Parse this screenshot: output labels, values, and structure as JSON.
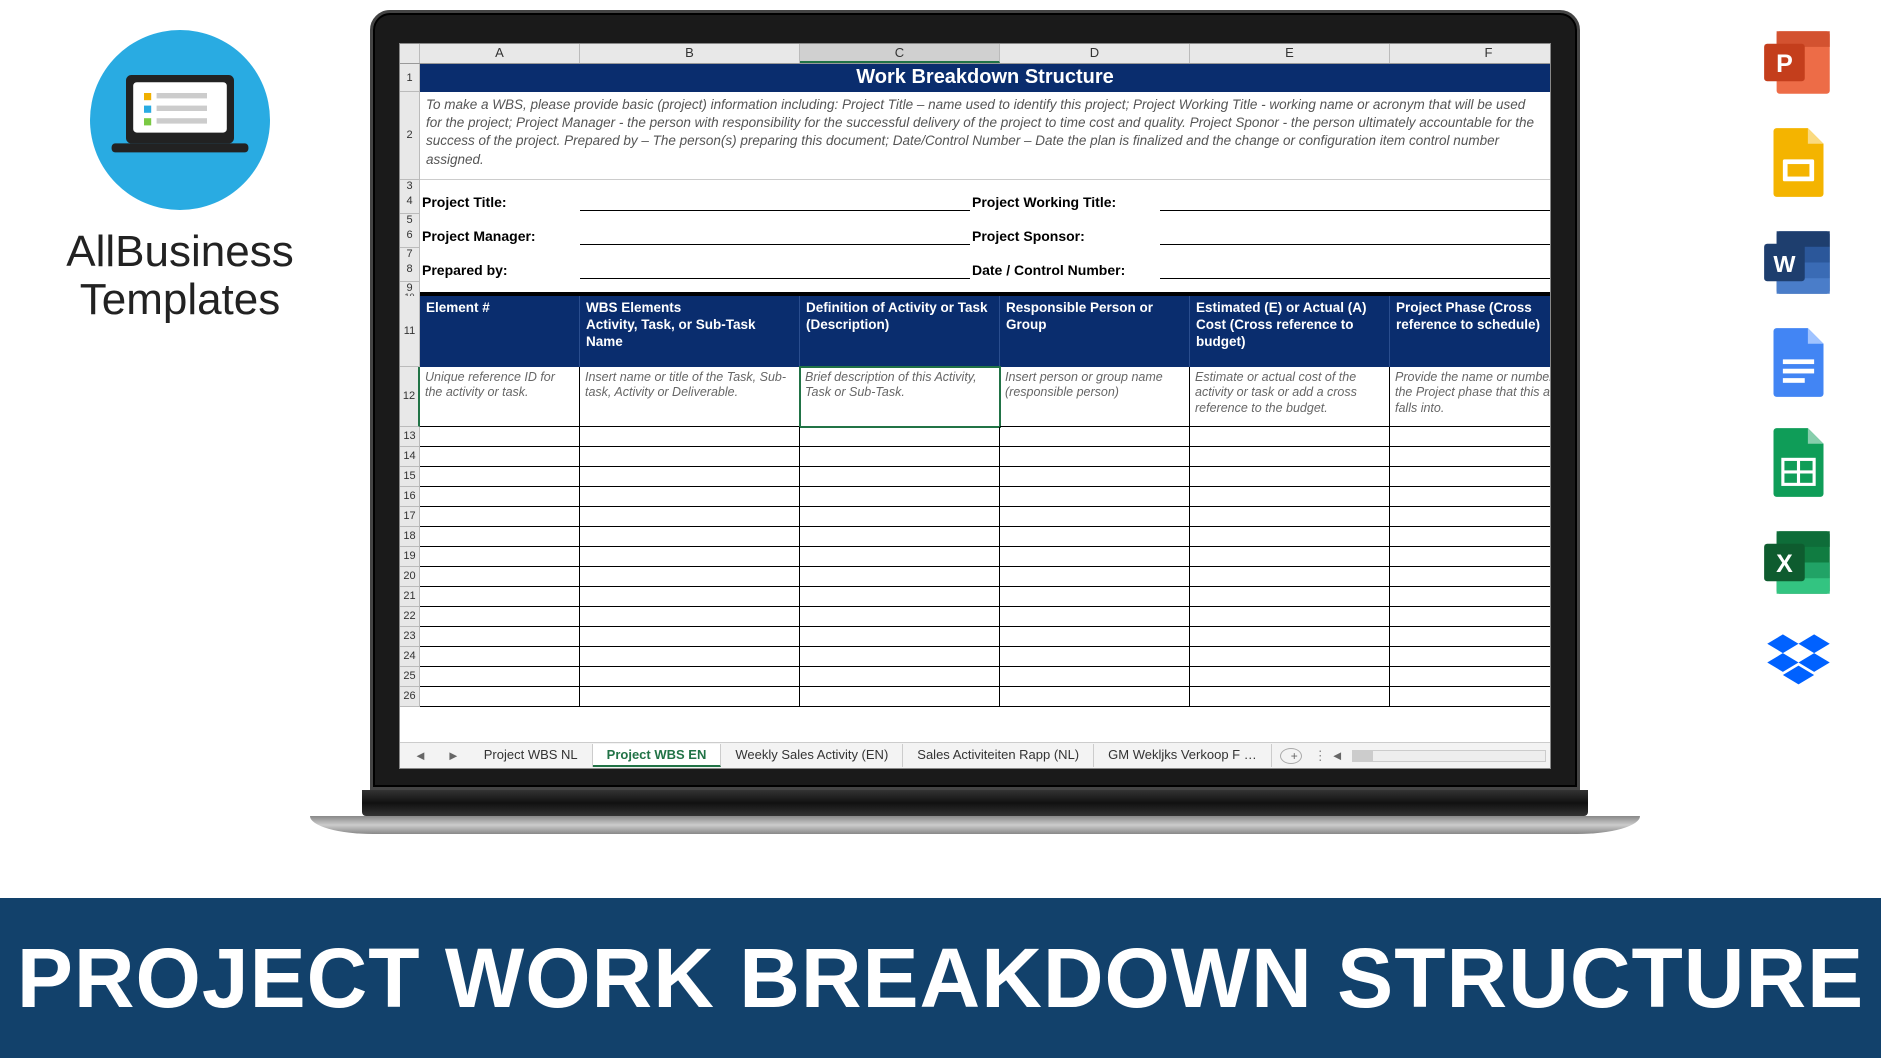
{
  "brand": {
    "line1": "AllBusiness",
    "line2": "Templates"
  },
  "banner": "PROJECT WORK BREAKDOWN STRUCTURE",
  "spreadsheet": {
    "columns": [
      "A",
      "B",
      "C",
      "D",
      "E",
      "F"
    ],
    "selected_column_index": 2,
    "title": "Work Breakdown Structure",
    "instructions": "To make a WBS, please provide basic (project) information including: Project Title – name used to identify this project; Project Working Title - working name or acronym that will be used for the project; Project Manager - the person with responsibility for the successful delivery of the project to time cost and quality. Project Sponor - the person ultimately accountable for the success of the project. Prepared by – The person(s) preparing this document; Date/Control Number – Date the plan is finalized and the change or configuration item control number assigned.",
    "info_rows": [
      {
        "row": "4",
        "left": "Project Title:",
        "right": "Project Working Title:"
      },
      {
        "row": "6",
        "left": "Project Manager:",
        "right": "Project Sponsor:"
      },
      {
        "row": "8",
        "left": "Prepared by:",
        "right": "Date / Control Number:"
      }
    ],
    "table_headers": [
      "Element #",
      "WBS Elements\nActivity, Task, or Sub-Task Name",
      "Definition of Activity or Task (Description)",
      "Responsible Person or Group",
      "Estimated (E) or Actual (A) Cost (Cross reference to budget)",
      "Project Phase (Cross reference to schedule)"
    ],
    "table_hints": [
      "Unique reference ID for the activity or task.",
      "Insert name or title of the Task, Sub-task, Activity or Deliverable.",
      "Brief description of this Activity, Task or Sub-Task.",
      "Insert person or group name (responsible person)",
      "Estimate or actual cost of the activity or task or add a cross reference to the budget.",
      "Provide the name or number of the Project phase that this activity falls into."
    ],
    "header_row_num": "11",
    "hint_row_num": "12",
    "active_hint_col": 2,
    "empty_rows": [
      "13",
      "14",
      "15",
      "16",
      "17",
      "18",
      "19",
      "20",
      "21",
      "22",
      "23",
      "24",
      "25",
      "26"
    ],
    "tabs": [
      {
        "label": "Project WBS NL",
        "active": false
      },
      {
        "label": "Project WBS EN",
        "active": true
      },
      {
        "label": "Weekly Sales Activity (EN)",
        "active": false
      },
      {
        "label": "Sales Activiteiten Rapp (NL)",
        "active": false
      },
      {
        "label": "GM Wekljks Verkoop F …",
        "active": false
      }
    ]
  },
  "right_icons": [
    "powerpoint",
    "google-slides",
    "word",
    "google-docs",
    "google-sheets",
    "excel",
    "dropbox"
  ]
}
